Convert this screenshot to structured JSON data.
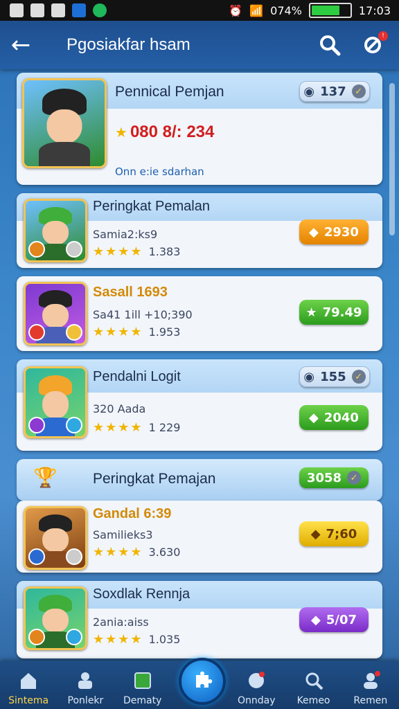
{
  "status_bar": {
    "battery": "074%",
    "time": "17:03"
  },
  "header": {
    "title": "Pgosiakfar hsam"
  },
  "featured": {
    "name": "Pennical Pemjan",
    "count": "137",
    "score": "080 8/: 234",
    "subtitle": "Onn e:ie sdarhan"
  },
  "players": [
    {
      "name": "Peringkat Pemalan",
      "sub": "Samia2:ks9",
      "rating_text": "1.383",
      "stars": 4,
      "points": "2930",
      "pill": "orange"
    },
    {
      "name": "Sasall 1693",
      "sub": "Sa41 1ill +10;390",
      "rating_text": "1.953",
      "stars": 4,
      "points": "79.49",
      "pill": "green"
    },
    {
      "name": "Pendalni Logit",
      "sub": "320 Aada",
      "rating_text": "1 229",
      "stars": 4,
      "points": "2040",
      "pill": "green",
      "badge": "155"
    }
  ],
  "section": {
    "title": "Peringkat Pemajan",
    "count": "3058"
  },
  "players2": [
    {
      "name": "Gandal 6:39",
      "sub": "Samilieks3",
      "rating_text": "3.630",
      "stars": 4,
      "points": "7;60",
      "pill": "yellow"
    },
    {
      "name": "Soxdlak Rennja",
      "sub": "2ania:aiss",
      "rating_text": "1.035",
      "stars": 4,
      "points": "5/07",
      "pill": "purple"
    }
  ],
  "nav": {
    "items": [
      "Sintema",
      "Ponlekr",
      "Dematy",
      "Onnday",
      "Kemeo",
      "Remen"
    ]
  },
  "colors": {
    "accent": "#ffd54a",
    "header_bg": "#1e4f8f",
    "score_red": "#d11e1e"
  }
}
